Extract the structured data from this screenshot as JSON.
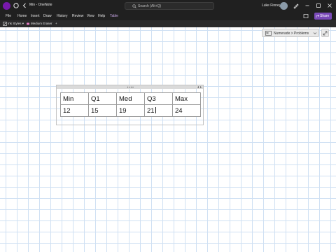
{
  "window": {
    "title": "Min - OneNote",
    "search_placeholder": "Search (Alt+Q)",
    "user_name": "Luke Finney"
  },
  "menu": {
    "items": [
      "File",
      "Home",
      "Insert",
      "Draw",
      "History",
      "Review",
      "View",
      "Help",
      "Table"
    ],
    "active": "Table",
    "share_label": "Share"
  },
  "toolbar": {
    "ink_styles_label": "Ink Styles",
    "medium_eraser_label": "Medium Eraser",
    "add_label": "+"
  },
  "numerade": {
    "label": "Numerade > Problems"
  },
  "table": {
    "headers": [
      "Min",
      "Q1",
      "Med",
      "Q3",
      "Max"
    ],
    "values": [
      "12",
      "15",
      "19",
      "21",
      "24"
    ]
  },
  "colors": {
    "accent": "#7a4ab8",
    "app_icon": "#7719aa",
    "title_bar": "#202020",
    "grid_line": "#cfe0f3"
  },
  "icons": [
    "onenote-app-icon",
    "sync-icon",
    "back-icon",
    "search-icon",
    "settings-icon",
    "pen-icon",
    "minimize-icon",
    "restore-icon",
    "close-icon",
    "notification-icon",
    "share-icon",
    "ink-styles-icon",
    "eraser-icon",
    "numerade-icon",
    "chevron-down-icon",
    "expand-icon"
  ]
}
